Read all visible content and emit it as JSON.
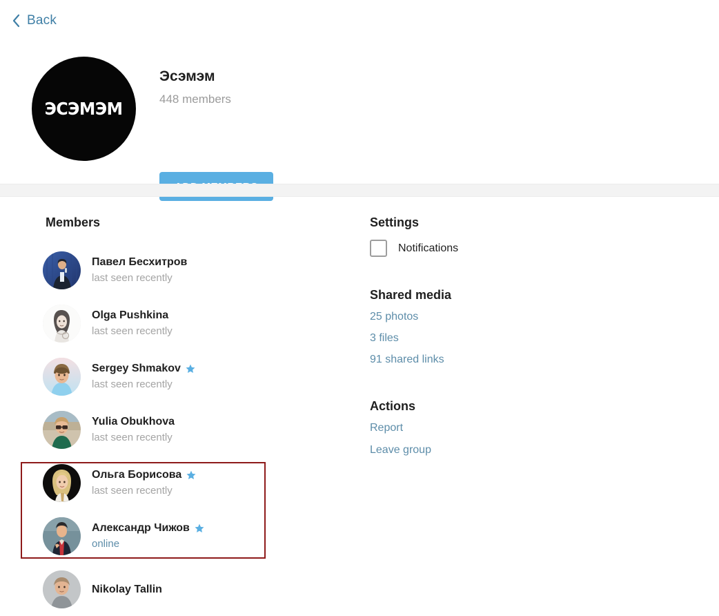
{
  "nav": {
    "back_label": "Back",
    "back_icon": "chevron-left-icon"
  },
  "profile": {
    "avatar_text": "ЭСЭМЭМ",
    "title": "Эсэмэм",
    "subtitle": "448 members",
    "add_members_label": "ADD MEMBERS"
  },
  "members": {
    "heading": "Members",
    "items": [
      {
        "name": "Павел Бесхитров",
        "status": "last seen recently",
        "online": false,
        "admin": false
      },
      {
        "name": "Olga Pushkina",
        "status": "last seen recently",
        "online": false,
        "admin": false
      },
      {
        "name": "Sergey Shmakov",
        "status": "last seen recently",
        "online": false,
        "admin": true
      },
      {
        "name": "Yulia Obukhova",
        "status": "last seen recently",
        "online": false,
        "admin": false
      },
      {
        "name": "Ольга Борисова",
        "status": "last seen recently",
        "online": false,
        "admin": true
      },
      {
        "name": "Александр Чижов",
        "status": "online",
        "online": true,
        "admin": true
      },
      {
        "name": "Nikolay Tallin",
        "status": "",
        "online": false,
        "admin": false
      }
    ]
  },
  "settings": {
    "heading": "Settings",
    "notifications_label": "Notifications",
    "notifications_checked": false
  },
  "shared_media": {
    "heading": "Shared media",
    "links": [
      "25 photos",
      "3 files",
      "91 shared links"
    ]
  },
  "actions": {
    "heading": "Actions",
    "links": [
      "Report",
      "Leave group"
    ]
  },
  "colors": {
    "accent_blue": "#5aafe2",
    "link_blue": "#5d8da9",
    "highlight_red": "#8e1a1a",
    "muted_gray": "#a4a4a4"
  }
}
